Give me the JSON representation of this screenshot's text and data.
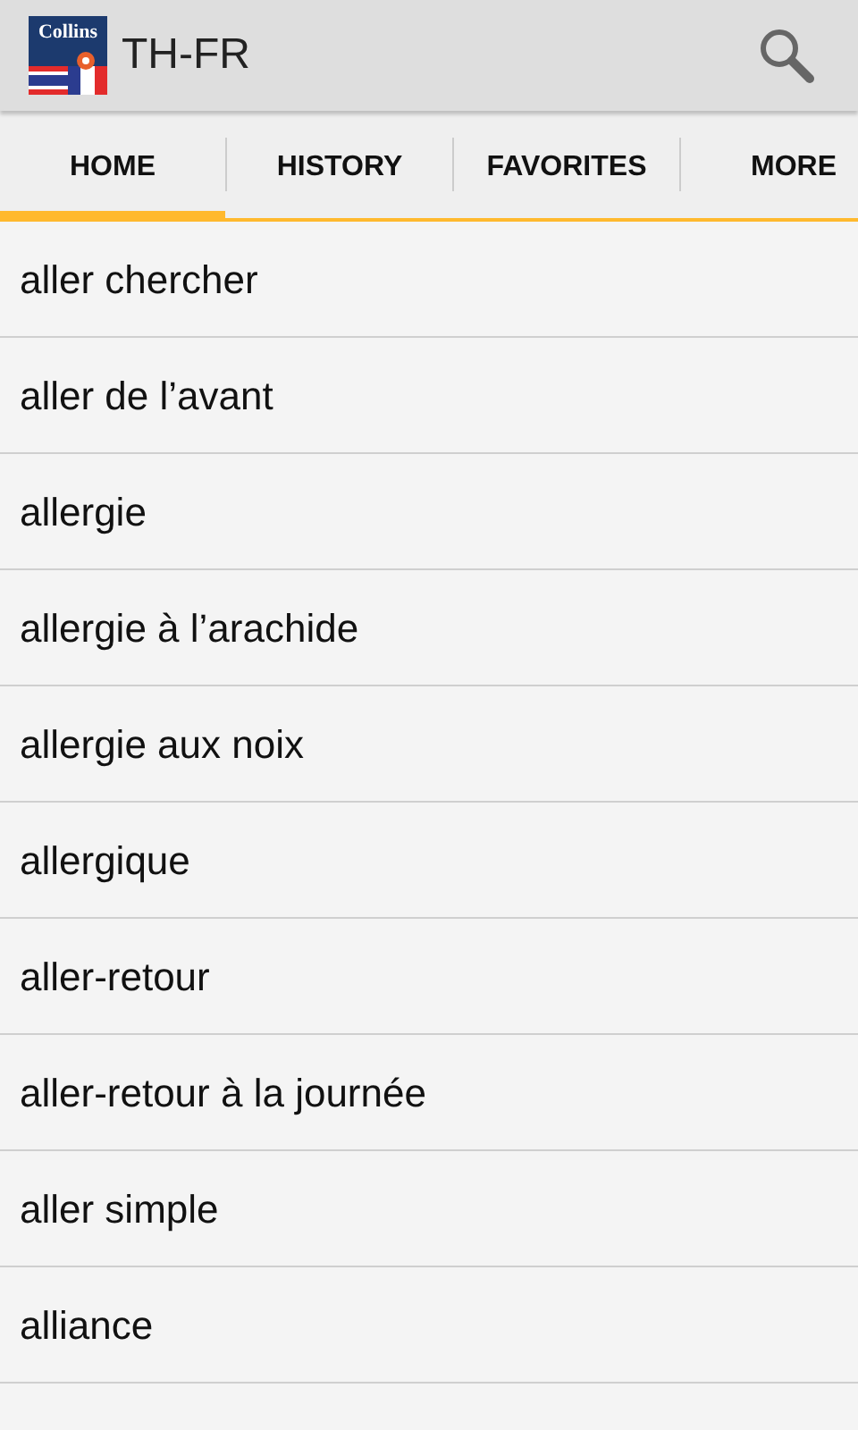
{
  "app_bar": {
    "logo_text": "Collins",
    "title": "TH-FR"
  },
  "tabs": [
    {
      "label": "HOME",
      "selected": true
    },
    {
      "label": "HISTORY",
      "selected": false
    },
    {
      "label": "FAVORITES",
      "selected": false
    },
    {
      "label": "MORE",
      "selected": false
    }
  ],
  "word_list": [
    "aller chercher",
    "aller de l’avant",
    "allergie",
    "allergie à l’arachide",
    "allergie aux noix",
    "allergique",
    "aller-retour",
    "aller-retour à la journée",
    "aller simple",
    "alliance"
  ]
}
